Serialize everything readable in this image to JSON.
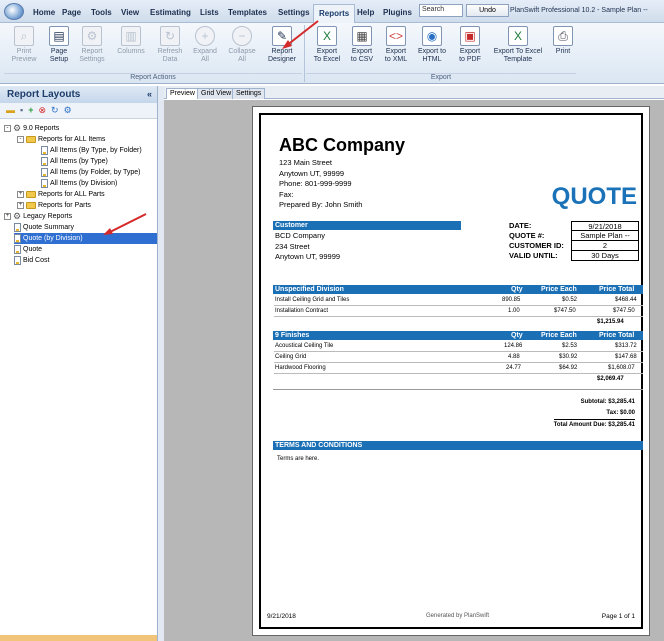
{
  "menubar": {
    "tabs": [
      "Home",
      "Page",
      "Tools",
      "View",
      "Estimating",
      "Lists",
      "Templates",
      "Settings",
      "Reports",
      "Help",
      "Plugins"
    ],
    "active_tab": "Reports",
    "search_placeholder": "Search",
    "undo_label": "Undo",
    "app_title": "PlanSwift Professional 10.2 - Sample Plan --"
  },
  "ribbon": {
    "report_actions": {
      "label": "Report Actions",
      "buttons": [
        {
          "label1": "Print",
          "label2": "Preview",
          "icon": "print-preview-icon",
          "disabled": true
        },
        {
          "label1": "Page",
          "label2": "Setup",
          "icon": "page-setup-icon",
          "disabled": false
        },
        {
          "label1": "Report",
          "label2": "Settings",
          "icon": "report-settings-icon",
          "disabled": true
        },
        {
          "label1": "Columns",
          "label2": "",
          "icon": "columns-icon",
          "disabled": true
        },
        {
          "label1": "Refresh",
          "label2": "Data",
          "icon": "refresh-icon",
          "disabled": true
        },
        {
          "label1": "Expand",
          "label2": "All",
          "icon": "plus-icon",
          "disabled": true
        },
        {
          "label1": "Collapse",
          "label2": "All",
          "icon": "minus-icon",
          "disabled": true
        },
        {
          "label1": "Report",
          "label2": "Designer",
          "icon": "report-designer-icon",
          "disabled": false
        }
      ]
    },
    "export": {
      "label": "Export",
      "buttons": [
        {
          "label1": "Export",
          "label2": "To Excel",
          "icon": "excel-icon"
        },
        {
          "label1": "Export",
          "label2": "to CSV",
          "icon": "csv-icon"
        },
        {
          "label1": "Export",
          "label2": "to XML",
          "icon": "xml-icon"
        },
        {
          "label1": "Export to",
          "label2": "HTML",
          "icon": "html-icon"
        },
        {
          "label1": "Export",
          "label2": "to PDF",
          "icon": "pdf-icon"
        },
        {
          "label1": "Export To Excel",
          "label2": "Template",
          "icon": "excel-template-icon"
        },
        {
          "label1": "Print",
          "label2": "",
          "icon": "printer-icon"
        }
      ]
    }
  },
  "left_panel": {
    "title": "Report Layouts",
    "collapse_glyph": "«",
    "tree": [
      {
        "label": "9.0 Reports",
        "level": 0,
        "type": "root",
        "toggle": "-"
      },
      {
        "label": "Reports for ALL Items",
        "level": 1,
        "type": "folder",
        "toggle": "-"
      },
      {
        "label": "All Items (By Type, by Folder)",
        "level": 2,
        "type": "doc"
      },
      {
        "label": "All Items (by Type)",
        "level": 2,
        "type": "doc"
      },
      {
        "label": "All Items (by Folder, by Type)",
        "level": 2,
        "type": "doc"
      },
      {
        "label": "All Items (by Division)",
        "level": 2,
        "type": "doc"
      },
      {
        "label": "Reports for ALL Parts",
        "level": 1,
        "type": "folder",
        "toggle": "+"
      },
      {
        "label": "Reports for Parts",
        "level": 1,
        "type": "folder",
        "toggle": "+"
      },
      {
        "label": "Legacy Reports",
        "level": 0,
        "type": "root",
        "toggle": "+"
      },
      {
        "label": "Quote Summary",
        "level": 0,
        "type": "doc"
      },
      {
        "label": "Quote (by Division)",
        "level": 0,
        "type": "doc",
        "selected": true
      },
      {
        "label": "Quote",
        "level": 0,
        "type": "doc"
      },
      {
        "label": "Bid Cost",
        "level": 0,
        "type": "doc"
      }
    ]
  },
  "preview_tabs": [
    "Preview",
    "Grid View",
    "Settings"
  ],
  "quote": {
    "company": "ABC Company",
    "address1": "123 Main Street",
    "address2": "Anytown UT, 99999",
    "phone": "Phone: 801-999-9999",
    "fax": "Fax:",
    "prepared_by": "Prepared By: John Smith",
    "doc_title": "QUOTE",
    "customer_header": "Customer",
    "customer_name": "BCD Company",
    "customer_addr1": "234 Street",
    "customer_addr2": "Anytown UT, 99999",
    "info": [
      {
        "label": "DATE:",
        "value": "9/21/2018"
      },
      {
        "label": "QUOTE #:",
        "value": "Sample Plan --"
      },
      {
        "label": "CUSTOMER ID:",
        "value": "2"
      },
      {
        "label": "VALID UNTIL:",
        "value": "30 Days"
      }
    ],
    "col_qty": "Qty",
    "col_price_each": "Price Each",
    "col_price_total": "Price Total",
    "divisions": [
      {
        "name": "Unspecified Division",
        "rows": [
          {
            "item": "Install Ceiling Grid and Tiles",
            "qty": "890.85",
            "each": "$0.52",
            "total": "$468.44"
          },
          {
            "item": "Installation Contract",
            "qty": "1.00",
            "each": "$747.50",
            "total": "$747.50"
          }
        ],
        "subtotal": "$1,215.94"
      },
      {
        "name": "9 Finishes",
        "rows": [
          {
            "item": "Acoustical Ceiling Tile",
            "qty": "124.86",
            "each": "$2.53",
            "total": "$313.72"
          },
          {
            "item": "Ceiling Grid",
            "qty": "4.88",
            "each": "$30.92",
            "total": "$147.68"
          },
          {
            "item": "Hardwood Flooring",
            "qty": "24.77",
            "each": "$64.92",
            "total": "$1,608.07"
          }
        ],
        "subtotal": "$2,069.47"
      }
    ],
    "subtotal_label": "Subtotal: $3,285.41",
    "tax_label": "Tax: $0.00",
    "total_label": "Total Amount Due: $3,285.41",
    "terms_header": "TERMS AND CONDITIONS",
    "terms_text": "Terms are here.",
    "footer_date": "9/21/2018",
    "footer_generated": "Generated by PlanSwift",
    "footer_page": "Page 1 of 1"
  },
  "colors": {
    "accent": "#1a6fb5",
    "quote_title": "#1a73b8",
    "selected": "#2e6fd1",
    "annotation_arrow": "#d42a2a"
  }
}
